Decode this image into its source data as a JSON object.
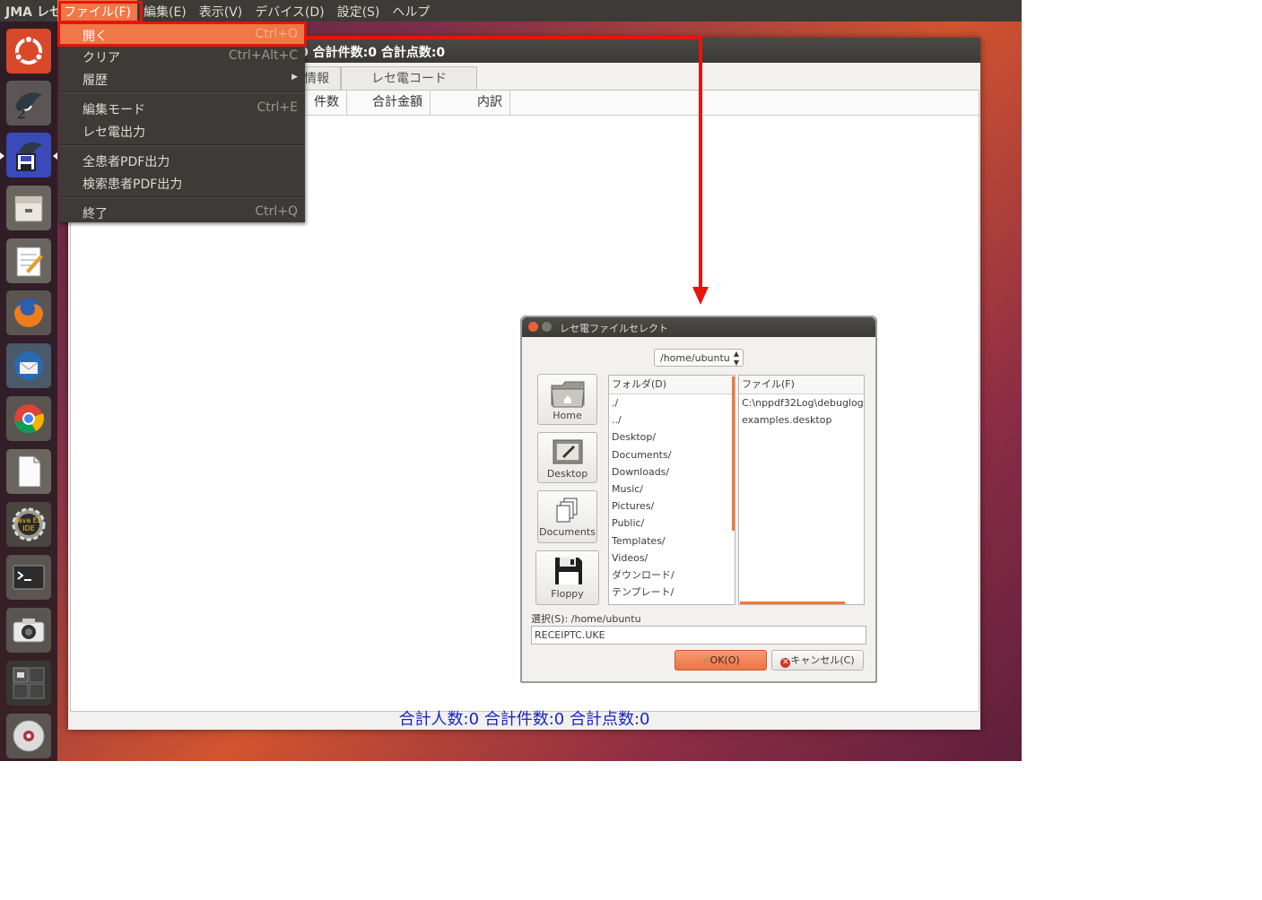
{
  "topbar": {
    "app_title": "JMA レセ",
    "menus": [
      "ファイル(F)",
      "編集(E)",
      "表示(V)",
      "デバイス(D)",
      "設定(S)",
      "ヘルプ"
    ]
  },
  "launcher": {
    "items": [
      "ubuntu-dash-icon",
      "orca-app-icon",
      "orca-save-app-icon",
      "files-icon",
      "text-editor-icon",
      "firefox-icon",
      "thunderbird-icon",
      "chrome-icon",
      "libreoffice-icon",
      "java-ee-ide-icon",
      "terminal-icon",
      "camera-icon",
      "workspace-switcher-icon",
      "dvd-icon"
    ],
    "java_label_1": "Java EE",
    "java_label_2": "IDE"
  },
  "main_window": {
    "title": "0 合計件数:0 合計点数:0",
    "tabs": [
      "情報",
      "レセ電コード"
    ],
    "columns": [
      "件数",
      "合計金額",
      "内訳"
    ],
    "status": "合計人数:0  合計件数:0  合計点数:0"
  },
  "file_menu": {
    "items": [
      {
        "label": "開く",
        "shortcut": "Ctrl+O"
      },
      {
        "label": "クリア",
        "shortcut": "Ctrl+Alt+C"
      },
      {
        "label": "履歴",
        "shortcut": ""
      },
      {
        "label": "編集モード",
        "shortcut": "Ctrl+E"
      },
      {
        "label": "レセ電出力",
        "shortcut": ""
      },
      {
        "label": "全患者PDF出力",
        "shortcut": ""
      },
      {
        "label": "検索患者PDF出力",
        "shortcut": ""
      },
      {
        "label": "終了",
        "shortcut": "Ctrl+Q"
      }
    ]
  },
  "dialog": {
    "title": "レセ電ファイルセレクト",
    "path": "/home/ubuntu",
    "shortcuts": [
      "Home",
      "Desktop",
      "Documents",
      "Floppy"
    ],
    "folder_header": "フォルダ(D)",
    "folders": [
      "./",
      "../",
      "Desktop/",
      "Documents/",
      "Downloads/",
      "Music/",
      "Pictures/",
      "Public/",
      "Templates/",
      "Videos/",
      "ダウンロード/",
      "テンプレート/"
    ],
    "file_header": "ファイル(F)",
    "files": [
      "C:\\nppdf32Log\\debuglog",
      "examples.desktop"
    ],
    "selection_label": "選択(S): /home/ubuntu",
    "filename": "RECEIPTC.UKE",
    "ok_label": "OK(O)",
    "cancel_label": "キャンセル(C)"
  },
  "colors": {
    "accent": "#f07746",
    "annotation_red": "#e8140c",
    "status_blue": "#1a24c8",
    "panel_dark": "#3c3b37"
  }
}
